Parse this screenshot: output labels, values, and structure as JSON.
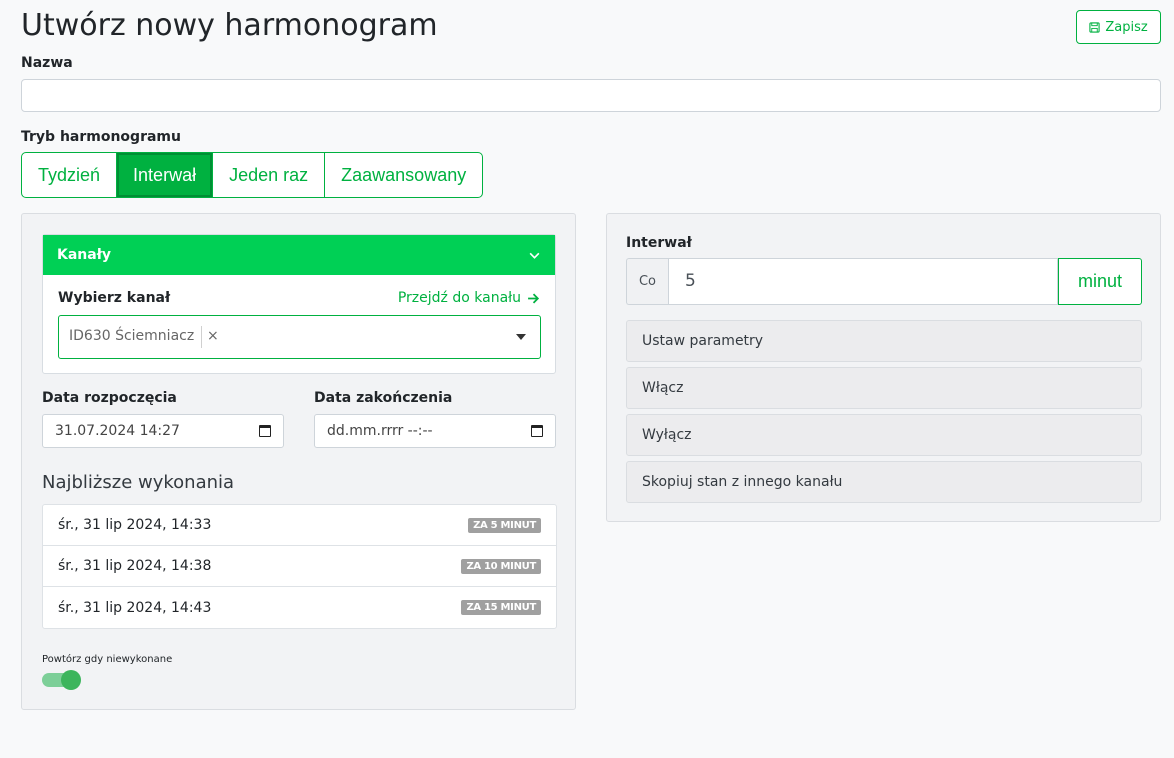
{
  "header": {
    "title": "Utwórz nowy harmonogram",
    "save_label": "Zapisz"
  },
  "form": {
    "name_label": "Nazwa",
    "name_value": "",
    "mode_label": "Tryb harmonogramu",
    "modes": [
      "Tydzień",
      "Interwał",
      "Jeden raz",
      "Zaawansowany"
    ],
    "active_mode": "Interwał"
  },
  "channels": {
    "header": "Kanały",
    "choose_label": "Wybierz kanał",
    "goto_link": "Przejdź do kanału",
    "selected": "ID630 Ściemniacz",
    "clear": "×"
  },
  "dates": {
    "start_label": "Data rozpoczęcia",
    "start_value": "31.07.2024 14:27",
    "end_label": "Data zakończenia",
    "end_value": "dd.mm.rrrr --:--"
  },
  "executions": {
    "title": "Najbliższe wykonania",
    "items": [
      {
        "date": "śr., 31 lip 2024, 14:33",
        "badge": "ZA 5 MINUT"
      },
      {
        "date": "śr., 31 lip 2024, 14:38",
        "badge": "ZA 10 MINUT"
      },
      {
        "date": "śr., 31 lip 2024, 14:43",
        "badge": "ZA 15 MINUT"
      }
    ]
  },
  "repeat": {
    "label": "Powtórz gdy niewykonane",
    "enabled": true
  },
  "interval": {
    "label": "Interwał",
    "prefix": "Co",
    "value": "5",
    "unit": "minut"
  },
  "actions": [
    "Ustaw parametry",
    "Włącz",
    "Wyłącz",
    "Skopiuj stan z innego kanału"
  ],
  "colors": {
    "accent": "#00b140",
    "panel_header": "#00d055",
    "badge": "#a0a0a0"
  }
}
